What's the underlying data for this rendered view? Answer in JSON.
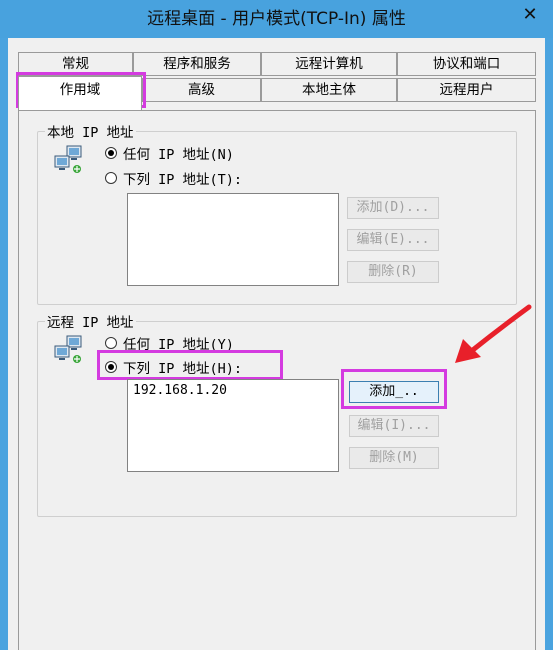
{
  "window": {
    "title": "远程桌面 - 用户模式(TCP-In) 属性",
    "close_label": "✕"
  },
  "tabs_row1": [
    {
      "label": "常规"
    },
    {
      "label": "程序和服务"
    },
    {
      "label": "远程计算机"
    },
    {
      "label": "协议和端口"
    }
  ],
  "tabs_row2": [
    {
      "label": "作用域"
    },
    {
      "label": "高级"
    },
    {
      "label": "本地主体"
    },
    {
      "label": "远程用户"
    }
  ],
  "local_ip": {
    "group_label": "本地 IP 地址",
    "any_label": "任何 IP 地址(N)",
    "list_label": "下列 IP 地址(T):",
    "selected": "any",
    "entries": [],
    "add_label": "添加(D)...",
    "edit_label": "编辑(E)...",
    "delete_label": "删除(R)"
  },
  "remote_ip": {
    "group_label": "远程 IP 地址",
    "any_label": "任何 IP 地址(Y)",
    "list_label": "下列 IP 地址(H):",
    "selected": "list",
    "entries": [
      "192.168.1.20"
    ],
    "add_label": "添加_..",
    "edit_label": "编辑(I)...",
    "delete_label": "删除(M)"
  },
  "colors": {
    "titlebar": "#48a2de",
    "highlight": "#d43be0",
    "arrow": "#e8202a"
  },
  "icons": {
    "network": "network-computers-icon",
    "close": "close-icon"
  }
}
